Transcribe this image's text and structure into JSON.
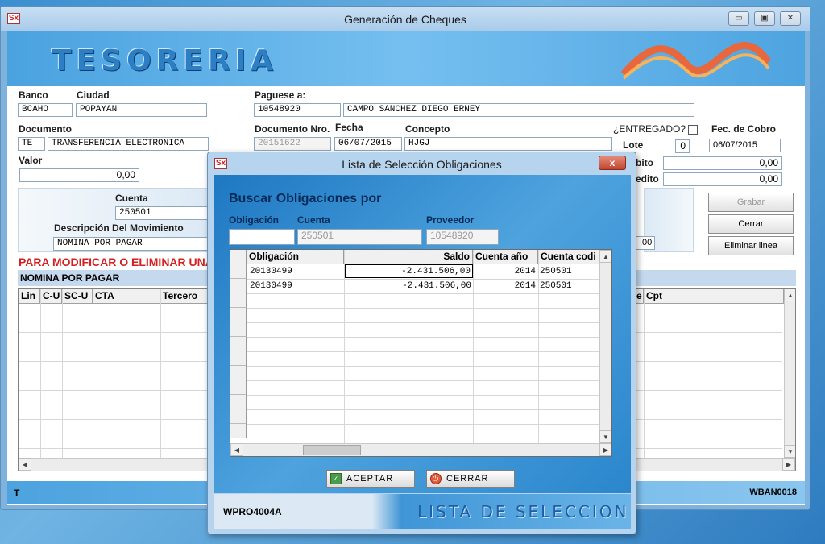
{
  "main_window": {
    "title": "Generación de Cheques",
    "app_icon_glyph": "Sx",
    "banner": "TESORERIA",
    "form": {
      "banco_label": "Banco",
      "banco_value": "BCAHO",
      "ciudad_label": "Ciudad",
      "ciudad_value": "POPAYAN",
      "paguese_label": "Paguese  a:",
      "paguese_id": "10548920",
      "paguese_name": "CAMPO SANCHEZ DIEGO ERNEY",
      "documento_label": "Documento",
      "documento_code": "TE",
      "documento_desc": "TRANSFERENCIA ELECTRONICA",
      "documento_nro_label": "Documento Nro.",
      "documento_nro_value": "20151622",
      "fecha_label": "Fecha",
      "fecha_value": "06/07/2015",
      "concepto_label": "Concepto",
      "concepto_value": "HJGJ",
      "entregado_label": "¿ENTREGADO?",
      "fec_cobro_label": "Fec. de Cobro",
      "fec_cobro_value": "06/07/2015",
      "lote_label": "Lote",
      "lote_value": "0",
      "debito_label": "bito",
      "debito_value": "0,00",
      "credito_label": "edito",
      "credito_value": "0,00",
      "valor_label": "Valor",
      "valor_value": "0,00",
      "cuenta_label": "Cuenta",
      "cuenta_value": "250501",
      "desc_mov_label": "Descripción Del Movimiento",
      "desc_mov_value": "NOMINA POR PAGAR",
      "partial_amount": ",00"
    },
    "buttons": {
      "grabar": "Grabar",
      "cerrar": "Cerrar",
      "eliminar": "Eliminar linea"
    },
    "warning": "PARA MODIFICAR O ELIMINAR UNA",
    "nomina_bar": "NOMINA POR PAGAR",
    "grid_headers": [
      "Lin",
      "C-U",
      "SC-U",
      "CTA",
      "Tercero",
      "e",
      "Cpt"
    ],
    "status_left": "T",
    "status_right": "WBAN0018"
  },
  "dialog": {
    "title": "Lista de Selección Obligaciones",
    "close_glyph": "x",
    "heading": "Buscar Obligaciones por",
    "obligacion_label": "Obligación",
    "obligacion_value": "",
    "cuenta_label": "Cuenta",
    "cuenta_value": "250501",
    "proveedor_label": "Proveedor",
    "proveedor_value": "10548920",
    "grid_headers": [
      "Obligación",
      "Saldo",
      "Cuenta  año",
      "Cuenta codi"
    ],
    "rows": [
      {
        "obligacion": "20130499",
        "saldo": "-2.431.506,00",
        "anio": "2014",
        "cuenta": "250501"
      },
      {
        "obligacion": "20130499",
        "saldo": "-2.431.506,00",
        "anio": "2014",
        "cuenta": "250501"
      }
    ],
    "aceptar": "ACEPTAR",
    "cerrar": "CERRAR",
    "footer_code": "WPRO4004A",
    "footer_title": "LISTA DE SELECCION"
  }
}
